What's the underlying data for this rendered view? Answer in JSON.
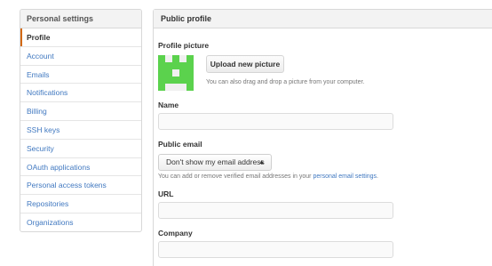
{
  "sidebar": {
    "header": "Personal settings",
    "items": [
      {
        "label": "Profile",
        "selected": true
      },
      {
        "label": "Account"
      },
      {
        "label": "Emails"
      },
      {
        "label": "Notifications"
      },
      {
        "label": "Billing"
      },
      {
        "label": "SSH keys"
      },
      {
        "label": "Security"
      },
      {
        "label": "OAuth applications"
      },
      {
        "label": "Personal access tokens"
      },
      {
        "label": "Repositories"
      },
      {
        "label": "Organizations"
      }
    ]
  },
  "main": {
    "title": "Public profile",
    "profile_picture": {
      "label": "Profile picture",
      "upload_label": "Upload new picture",
      "hint": "You can also drag and drop a picture from your computer.",
      "avatar_icon": "identicon-icon",
      "avatar_color": "#5bd24d"
    },
    "name": {
      "label": "Name",
      "value": ""
    },
    "public_email": {
      "label": "Public email",
      "selected": "Don't show my email address",
      "hint_prefix": "You can add or remove verified email addresses in your ",
      "hint_link": "personal email settings",
      "hint_suffix": "."
    },
    "url": {
      "label": "URL",
      "value": ""
    },
    "company": {
      "label": "Company",
      "value": ""
    }
  },
  "colors": {
    "accent": "#d26911",
    "link": "#4078c0"
  }
}
